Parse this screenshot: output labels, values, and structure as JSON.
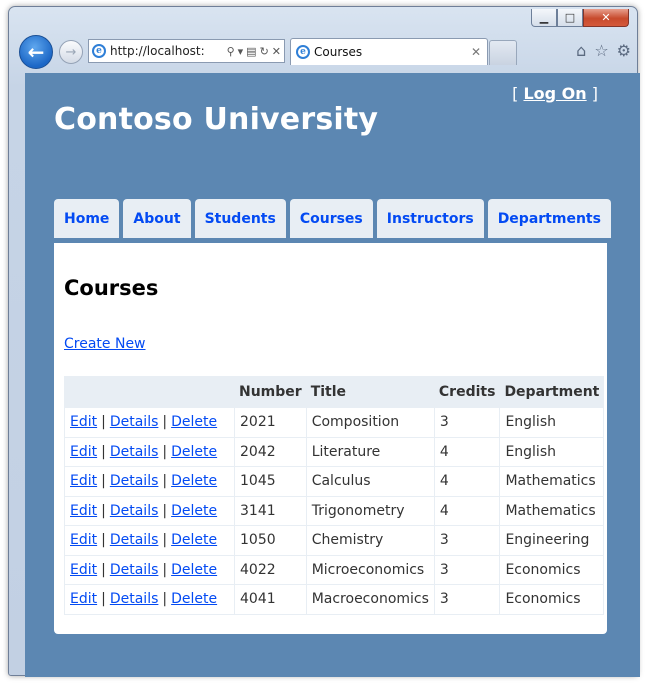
{
  "browser": {
    "address": "http://localhost:",
    "tab_title": "Courses",
    "window_buttons": {
      "minimize": "▁",
      "maximize": "□",
      "close": "✕"
    },
    "tab_close": "✕",
    "icons": {
      "back": "back-arrow-icon",
      "forward": "forward-arrow-icon",
      "home": "home-icon",
      "favorites": "star-icon",
      "tools": "gear-icon"
    }
  },
  "header": {
    "login_prefix": "[ ",
    "login_link": "Log On",
    "login_suffix": " ]",
    "site_title": "Contoso University"
  },
  "menu": [
    "Home",
    "About",
    "Students",
    "Courses",
    "Instructors",
    "Departments"
  ],
  "main": {
    "heading": "Courses",
    "create_link": "Create New",
    "row_actions": {
      "edit": "Edit",
      "details": "Details",
      "delete": "Delete",
      "separator": "|"
    },
    "columns": [
      "",
      "Number",
      "Title",
      "Credits",
      "Department"
    ],
    "rows": [
      {
        "number": "2021",
        "title": "Composition",
        "credits": "3",
        "department": "English"
      },
      {
        "number": "2042",
        "title": "Literature",
        "credits": "4",
        "department": "English"
      },
      {
        "number": "1045",
        "title": "Calculus",
        "credits": "4",
        "department": "Mathematics"
      },
      {
        "number": "3141",
        "title": "Trigonometry",
        "credits": "4",
        "department": "Mathematics"
      },
      {
        "number": "1050",
        "title": "Chemistry",
        "credits": "3",
        "department": "Engineering"
      },
      {
        "number": "4022",
        "title": "Microeconomics",
        "credits": "3",
        "department": "Economics"
      },
      {
        "number": "4041",
        "title": "Macroeconomics",
        "credits": "3",
        "department": "Economics"
      }
    ]
  },
  "colors": {
    "page_background": "#5c87b2",
    "link": "#034af3",
    "menu_tab": "#e8eef4"
  }
}
